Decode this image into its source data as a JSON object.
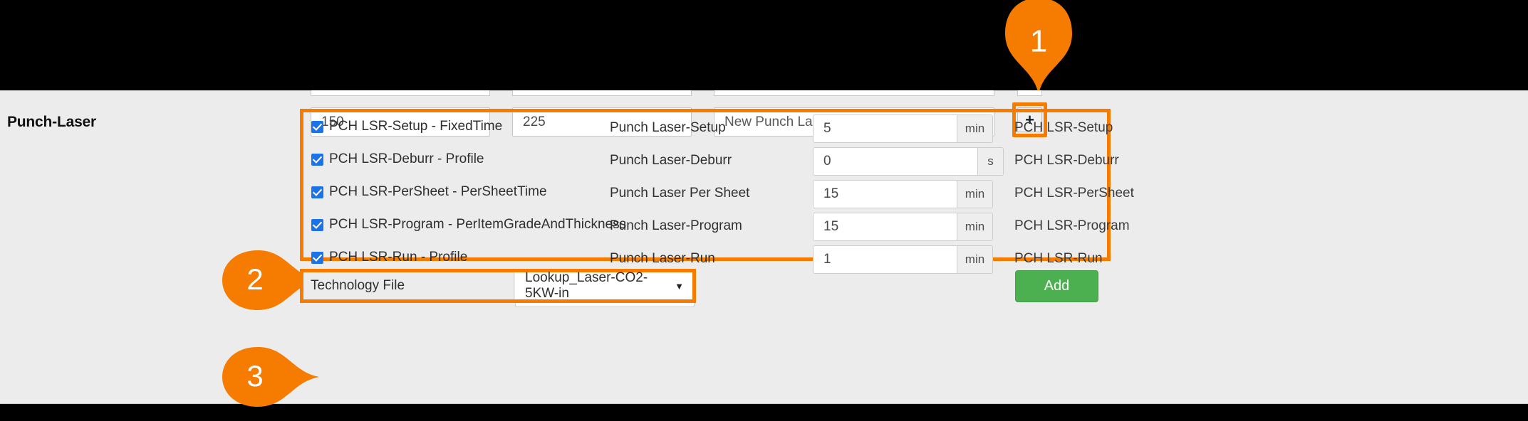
{
  "theme": {
    "accent_orange": "#f57c00",
    "panel_bg": "#ececec",
    "checkbox_blue": "#1a73e8",
    "add_button_green": "#4caf50",
    "page_bg": "#000000"
  },
  "header": {
    "title": "Punch-Laser",
    "field_a_value": "150",
    "field_b_value": "225",
    "field_c_value": "New Punch Laser",
    "add_row_button_label": "+"
  },
  "callouts": [
    {
      "number": "1",
      "target": "add-row-plus-button"
    },
    {
      "number": "2",
      "target": "operations-list"
    },
    {
      "number": "3",
      "target": "technology-file-row"
    }
  ],
  "operations": [
    {
      "checked": true,
      "checkbox_label": "PCH LSR-Setup - FixedTime",
      "operation_name": "Punch Laser-Setup",
      "value": "5",
      "unit": "min",
      "code": "PCH LSR-Setup"
    },
    {
      "checked": true,
      "checkbox_label": "PCH LSR-Deburr - Profile",
      "operation_name": "Punch Laser-Deburr",
      "value": "0",
      "unit": "s",
      "code": "PCH LSR-Deburr"
    },
    {
      "checked": true,
      "checkbox_label": "PCH LSR-PerSheet - PerSheetTime",
      "operation_name": "Punch Laser Per Sheet",
      "value": "15",
      "unit": "min",
      "code": "PCH LSR-PerSheet"
    },
    {
      "checked": true,
      "checkbox_label": "PCH LSR-Program - PerItemGradeAndThickness",
      "operation_name": "Punch Laser-Program",
      "value": "15",
      "unit": "min",
      "code": "PCH LSR-Program"
    },
    {
      "checked": true,
      "checkbox_label": "PCH LSR-Run - Profile",
      "operation_name": "Punch Laser-Run",
      "value": "1",
      "unit": "min",
      "code": "PCH LSR-Run"
    }
  ],
  "technology_file": {
    "label": "Technology File",
    "selected_option": "Lookup_Laser-CO2-5KW-in",
    "caret": "▼"
  },
  "footer": {
    "add_button_label": "Add"
  }
}
